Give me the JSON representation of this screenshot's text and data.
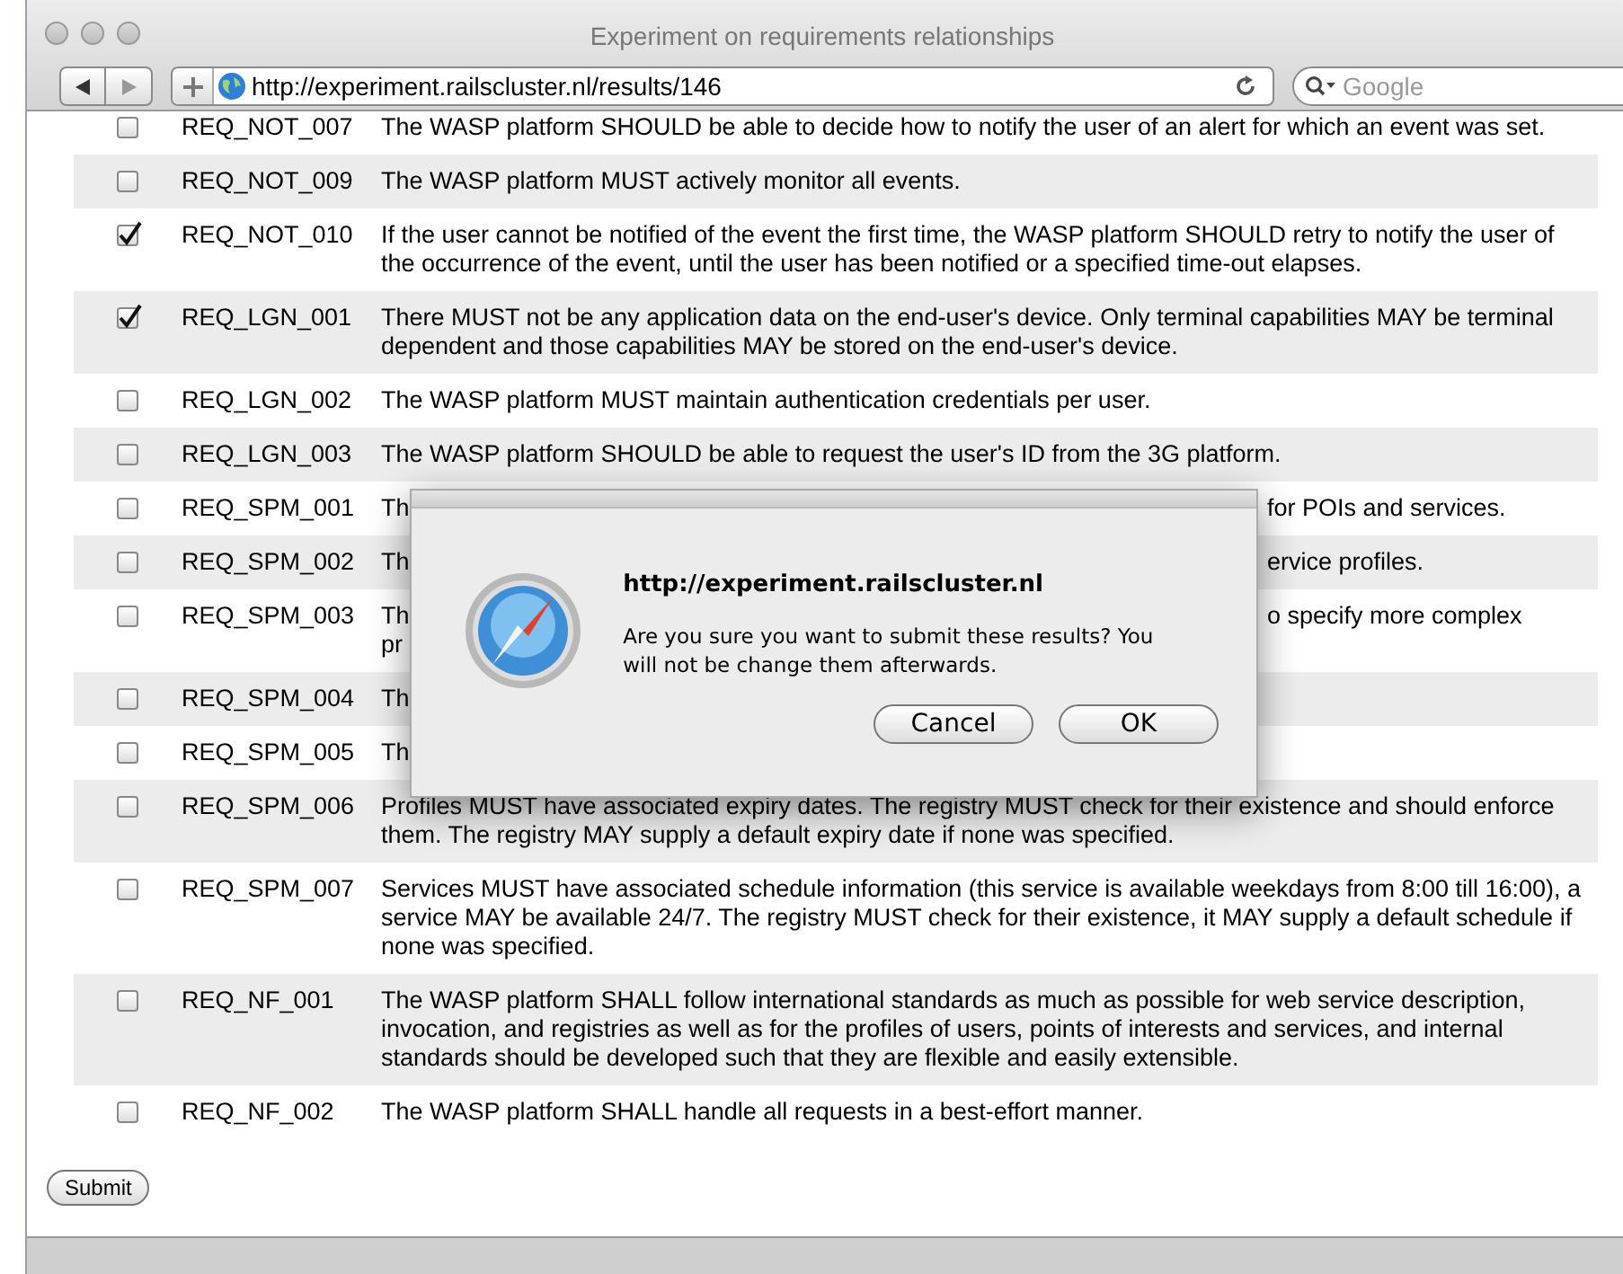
{
  "window": {
    "title": "Experiment on requirements relationships"
  },
  "toolbar": {
    "url": "http://experiment.railscluster.nl/results/146",
    "search": {
      "placeholder": "Google"
    }
  },
  "rows": [
    {
      "id": "REQ_NOT_007",
      "checked": false,
      "text": "The WASP platform SHOULD be able to decide how to notify the user of an alert for which an event was set."
    },
    {
      "id": "REQ_NOT_009",
      "checked": false,
      "text": "The WASP platform MUST actively monitor all events."
    },
    {
      "id": "REQ_NOT_010",
      "checked": true,
      "text": "If the user cannot be notified of the event the first time, the WASP platform SHOULD retry to notify the user of the occurrence of the event, until the user has been notified or a specified time-out elapses."
    },
    {
      "id": "REQ_LGN_001",
      "checked": true,
      "text": "There MUST not be any application data on the end-user's device. Only terminal capabilities MAY be terminal dependent and those capabilities MAY be stored on the end-user's device."
    },
    {
      "id": "REQ_LGN_002",
      "checked": false,
      "text": "The WASP platform MUST maintain authentication credentials per user."
    },
    {
      "id": "REQ_LGN_003",
      "checked": false,
      "text": "The WASP platform SHOULD be able to request the user's ID from the 3G platform."
    },
    {
      "id": "REQ_SPM_001",
      "checked": false,
      "text_start_lines": [
        "Th"
      ],
      "text_end": "for POIs and services."
    },
    {
      "id": "REQ_SPM_002",
      "checked": false,
      "text_start_lines": [
        "Th"
      ],
      "text_end": "ervice profiles."
    },
    {
      "id": "REQ_SPM_003",
      "checked": false,
      "text_start_lines": [
        "Th",
        "pr"
      ],
      "text_end": "o specify more complex"
    },
    {
      "id": "REQ_SPM_004",
      "checked": false,
      "text_start_lines": [
        "Th"
      ]
    },
    {
      "id": "REQ_SPM_005",
      "checked": false,
      "text_start_lines": [
        "Th"
      ]
    },
    {
      "id": "REQ_SPM_006",
      "checked": false,
      "text": "Profiles MUST have associated expiry dates. The registry MUST check for their existence and should enforce them. The registry MAY supply a default expiry date if none was specified."
    },
    {
      "id": "REQ_SPM_007",
      "checked": false,
      "text": "Services MUST have associated schedule information (this service is available weekdays from 8:00 till 16:00), a service MAY be available 24/7. The registry MUST check for their existence, it MAY supply a default schedule if none was specified."
    },
    {
      "id": "REQ_NF_001",
      "checked": false,
      "text": "The WASP platform SHALL follow international standards as much as possible for web service description, invocation, and registries as well as for the profiles of users, points of interests and services, and internal standards should be developed such that they are flexible and easily extensible."
    },
    {
      "id": "REQ_NF_002",
      "checked": false,
      "text": "The WASP platform SHALL handle all requests in a best-effort manner."
    }
  ],
  "submit_button": "Submit",
  "dialog": {
    "title": "http://experiment.railscluster.nl",
    "message": "Are you sure you want to submit these results? You will not be change them afterwards.",
    "buttons": [
      "Cancel",
      "OK"
    ]
  }
}
